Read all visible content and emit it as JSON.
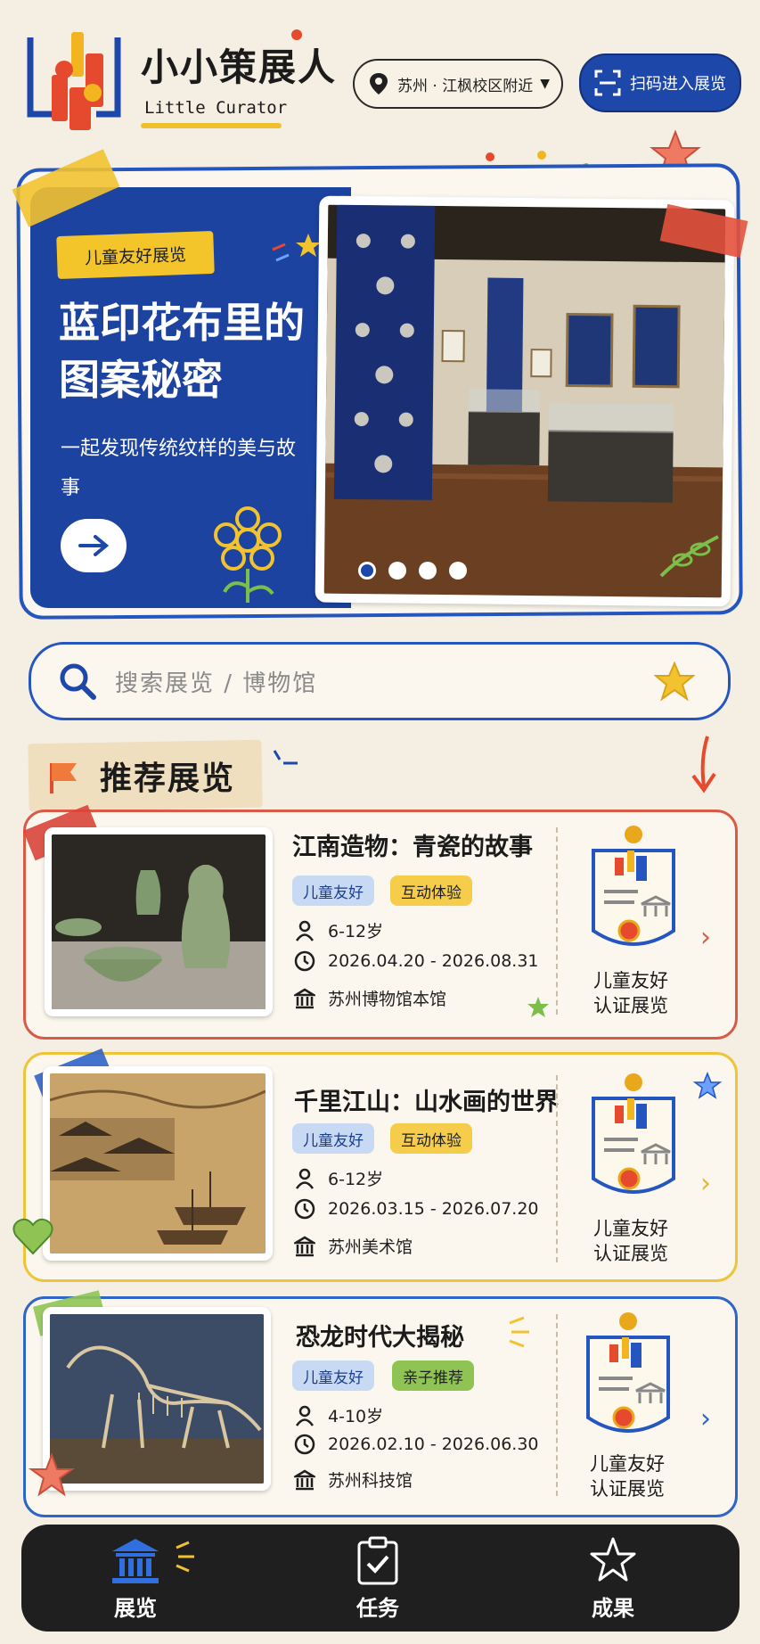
{
  "app": {
    "title": "小小策展人",
    "subtitle": "Little Curator"
  },
  "header": {
    "location": "苏州 · 江枫校区附近",
    "scan_button": "扫码进入展览"
  },
  "hero": {
    "tag": "儿童友好展览",
    "title": "蓝印花布里的图案秘密",
    "description": "一起发现传统纹样的美与故事",
    "slides_total": 4,
    "slide_active": 1
  },
  "search": {
    "placeholder": "搜索展览 / 博物馆"
  },
  "section": {
    "title": "推荐展览"
  },
  "exhibitions": [
    {
      "title": "江南造物：青瓷的故事",
      "tags": [
        "儿童友好",
        "互动体验"
      ],
      "age": "6-12岁",
      "dates": "2026.04.20 - 2026.08.31",
      "venue": "苏州博物馆本馆",
      "badge": "儿童友好\n认证展览",
      "badge_line1": "儿童友好",
      "badge_line2": "认证展览",
      "border_color": "#d95a46",
      "arrow_color": "#d95a46"
    },
    {
      "title": "千里江山：山水画的世界",
      "tags": [
        "儿童友好",
        "互动体验"
      ],
      "age": "6-12岁",
      "dates": "2026.03.15 - 2026.07.20",
      "venue": "苏州美术馆",
      "badge_line1": "儿童友好",
      "badge_line2": "认证展览",
      "border_color": "#eec43a",
      "arrow_color": "#e8b722"
    },
    {
      "title": "恐龙时代大揭秘",
      "tags": [
        "儿童友好",
        "亲子推荐"
      ],
      "age": "4-10岁",
      "dates": "2026.02.10 - 2026.06.30",
      "venue": "苏州科技馆",
      "badge_line1": "儿童友好",
      "badge_line2": "认证展览",
      "border_color": "#2f64c8",
      "arrow_color": "#2f64c8"
    }
  ],
  "nav": {
    "items": [
      {
        "label": "展览",
        "icon": "museum-icon",
        "active": true
      },
      {
        "label": "任务",
        "icon": "clipboard-check-icon",
        "active": false
      },
      {
        "label": "成果",
        "icon": "star-icon",
        "active": false
      }
    ]
  },
  "colors": {
    "background": "#f5efe3",
    "primary_blue": "#1d47a8",
    "accent_yellow": "#f4c42b",
    "accent_red": "#d95a46",
    "nav_bg": "#1f1f1f"
  }
}
